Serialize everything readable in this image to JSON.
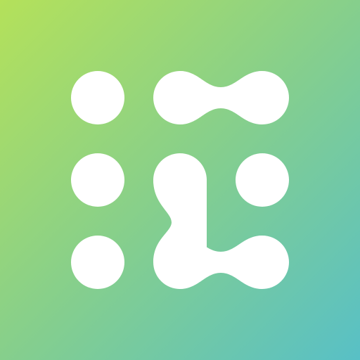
{
  "icon": {
    "background_gradient": {
      "start_color": "#B4E15A",
      "mid_color": "#86CF8C",
      "end_color": "#58C0C6"
    },
    "glyph_color": "#FFFFFF",
    "glyph_semantic": "dot-grid-connection-logo",
    "dot_grid": {
      "rows": 3,
      "columns": 3
    }
  }
}
